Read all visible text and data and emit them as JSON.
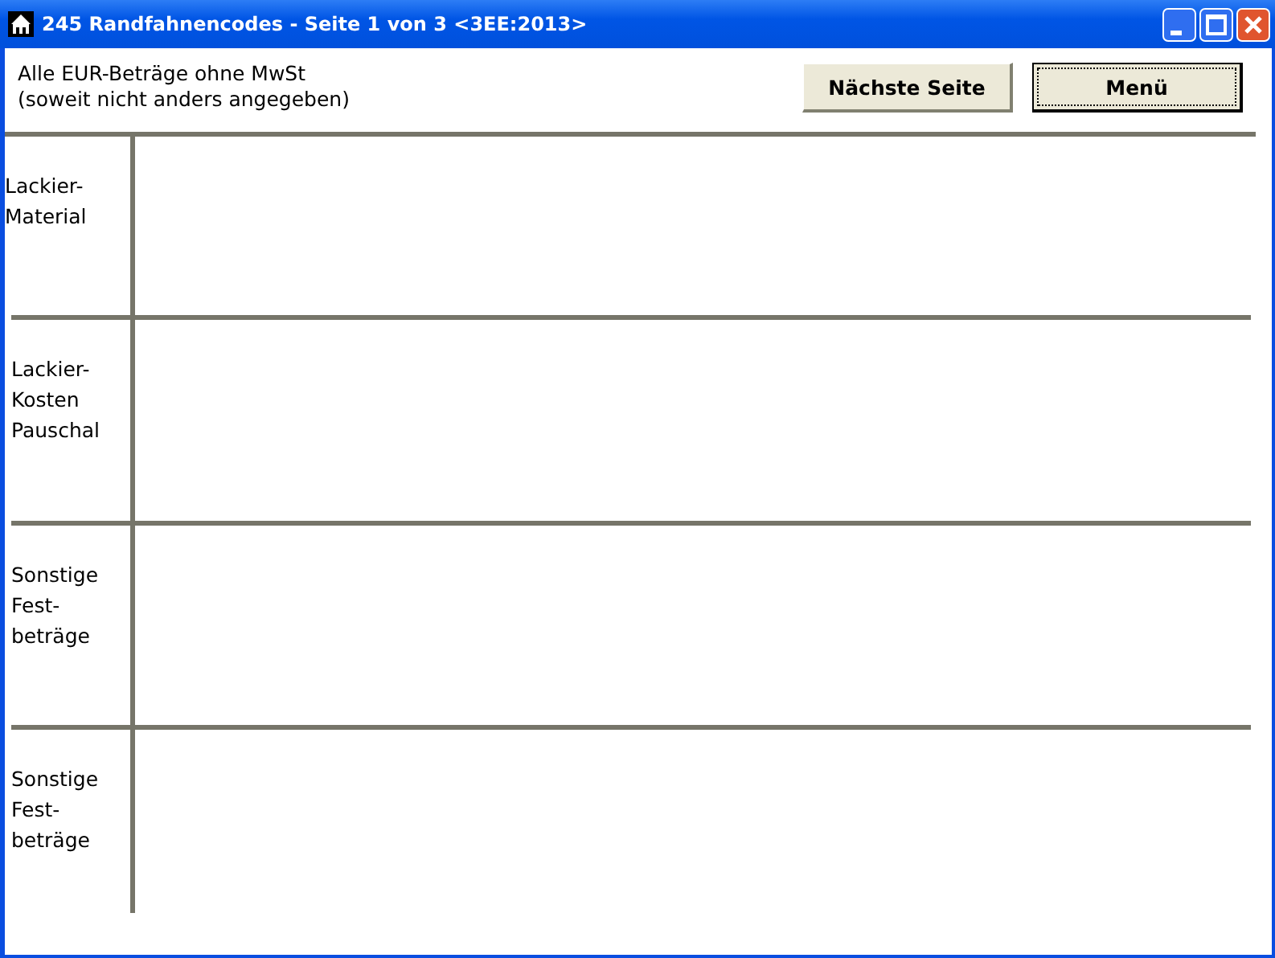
{
  "window": {
    "title": "245 Randfahnencodes - Seite 1 von 3 <3EE:2013>"
  },
  "note": "Alle EUR-Beträge ohne MwSt\n(soweit nicht anders angegeben)",
  "buttons": [
    {
      "label": "Nächste Seite",
      "focused": false
    },
    {
      "label": "Menü",
      "focused": true
    }
  ],
  "sections": [
    {
      "label": "Lackier-\nMaterial"
    },
    {
      "label": "Lackier-\nKosten\nPauschal"
    },
    {
      "label": "Sonstige\nFest-\nbeträge"
    },
    {
      "label": "Sonstige\nFest-\nbeträge"
    }
  ]
}
